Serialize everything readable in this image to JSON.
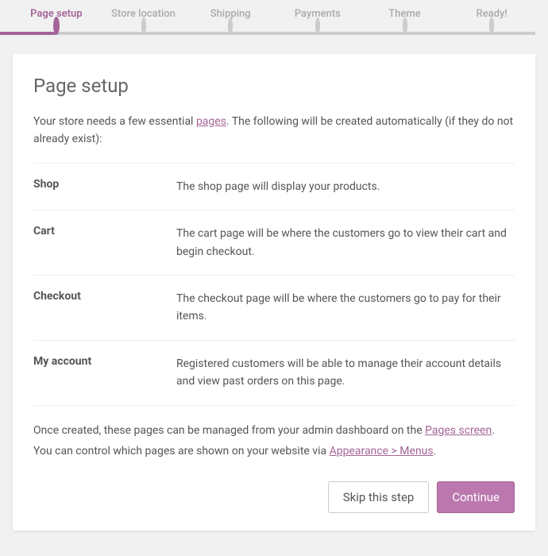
{
  "steps": [
    {
      "label": "Page setup",
      "active": true
    },
    {
      "label": "Store location",
      "active": false
    },
    {
      "label": "Shipping",
      "active": false
    },
    {
      "label": "Payments",
      "active": false
    },
    {
      "label": "Theme",
      "active": false
    },
    {
      "label": "Ready!",
      "active": false
    }
  ],
  "title": "Page setup",
  "intro": {
    "before": "Your store needs a few essential ",
    "link": "pages",
    "after": ". The following will be created automatically (if they do not already exist):"
  },
  "rows": [
    {
      "label": "Shop",
      "desc": "The shop page will display your products."
    },
    {
      "label": "Cart",
      "desc": "The cart page will be where the customers go to view their cart and begin checkout."
    },
    {
      "label": "Checkout",
      "desc": "The checkout page will be where the customers go to pay for their items."
    },
    {
      "label": "My account",
      "desc": "Registered customers will be able to manage their account details and view past orders on this page."
    }
  ],
  "outro": {
    "t1": "Once created, these pages can be managed from your admin dashboard on the ",
    "link1": "Pages screen",
    "t2": ". You can control which pages are shown on your website via ",
    "link2": "Appearance > Menus",
    "t3": "."
  },
  "buttons": {
    "skip": "Skip this step",
    "continue": "Continue"
  }
}
